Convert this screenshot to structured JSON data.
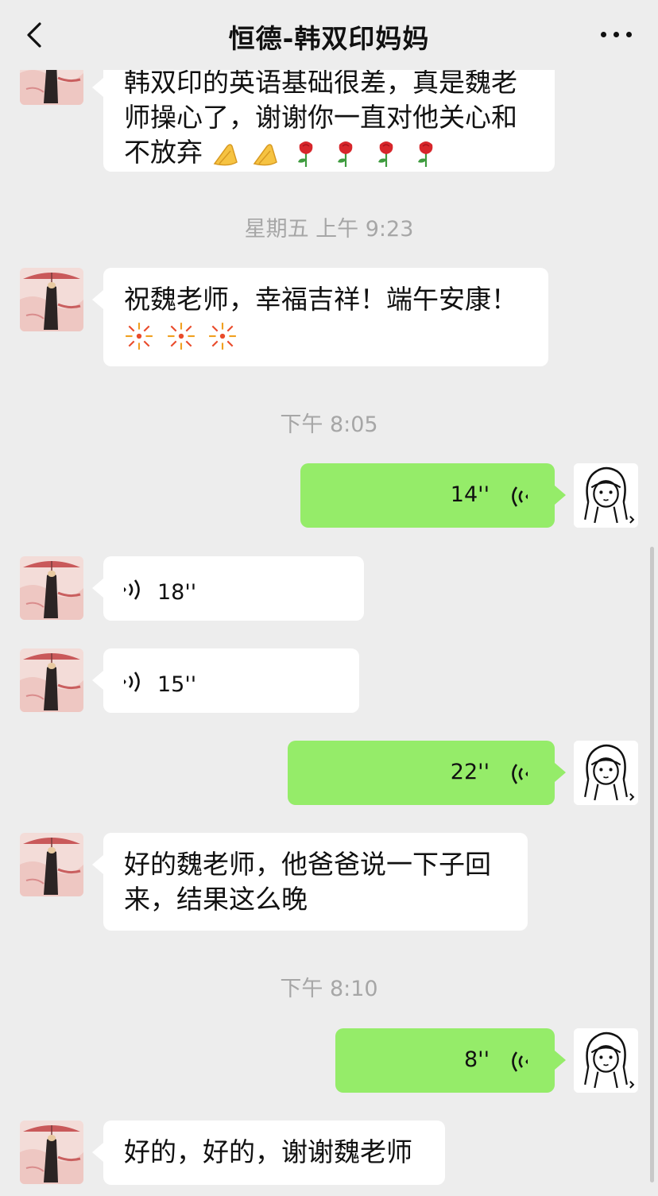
{
  "header": {
    "title": "恒德-韩双印妈妈",
    "back_icon": "chevron-left-icon",
    "more_icon": "more-dots-icon"
  },
  "messages": {
    "m1_line1": "韩双印的英语基础很差，真是魏老",
    "m1_line2": "师操心了，谢谢你一直对他关心和",
    "m1_line3": "不放弃",
    "ts1": "星期五 上午 9:23",
    "m2_line1": "祝魏老师，幸福吉祥！端午安康！",
    "ts2": "下午 8:05",
    "v_out1": "14''",
    "v_in1": "18''",
    "v_in2": "15''",
    "v_out2": "22''",
    "m3_line1": "好的魏老师，他爸爸说一下子回",
    "m3_line2": "来，结果这么晚",
    "ts3": "下午 8:10",
    "v_out3": "8''",
    "m4_line1": "好的，好的，谢谢魏老师"
  },
  "emoji": {
    "m1": [
      "praying-hands",
      "praying-hands",
      "rose",
      "rose",
      "rose",
      "rose"
    ],
    "m2": [
      "fireworks",
      "fireworks",
      "fireworks"
    ]
  },
  "colors": {
    "background": "#ededed",
    "outgoing_bubble": "#95ec69",
    "incoming_bubble": "#ffffff",
    "timestamp": "#a6a6a6"
  }
}
